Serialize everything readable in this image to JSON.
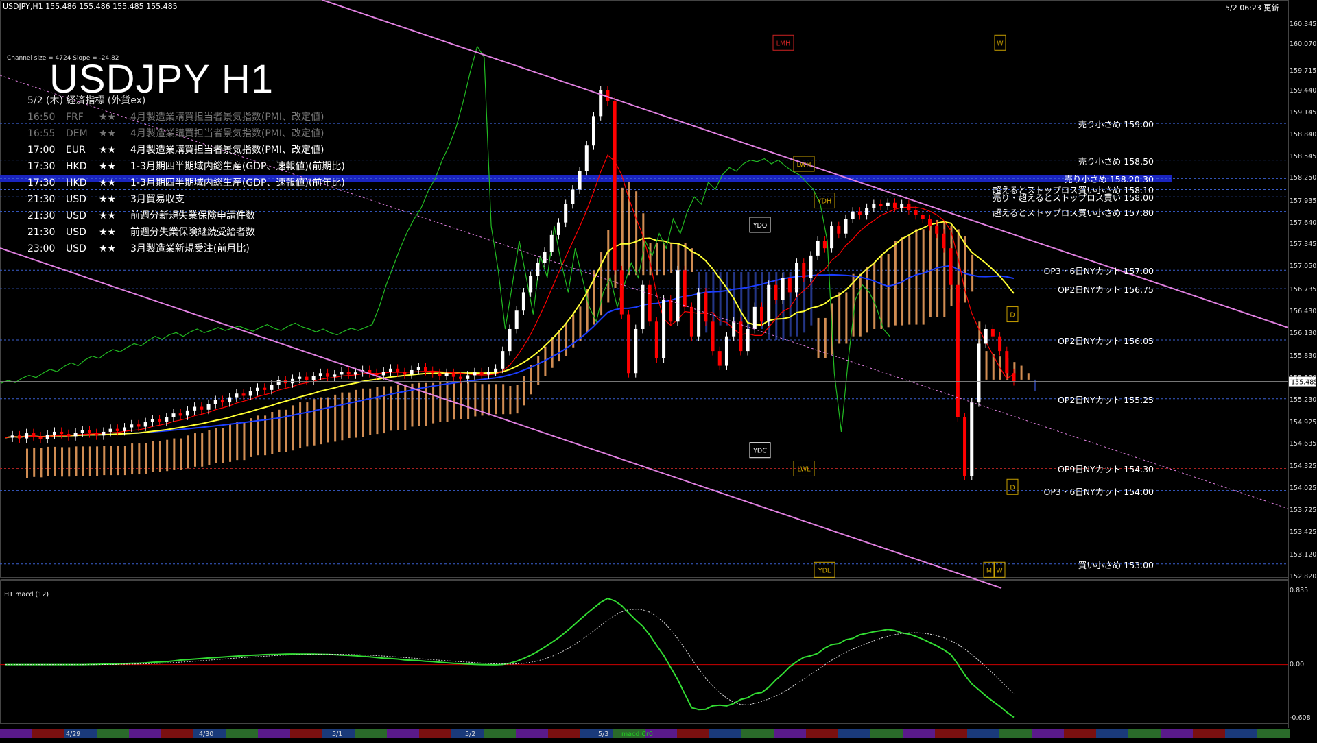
{
  "window": {
    "header": "USDJPY,H1  155.486 155.486 155.485 155.485",
    "timestamp": "5/2 06:23 更新"
  },
  "title": "USDJPY H1",
  "subtitle": "5/2 (木) 経済指標 (外貨ex)",
  "channel_info": "Channel size = 4724 Slope = -24.82",
  "colors": {
    "background": "#000000",
    "bull_candle": "#ffffff",
    "bear_candle": "#ff0000",
    "ma_fast": "#ff0000",
    "ma_mid": "#ffff33",
    "ma_slow": "#1a3cff",
    "chikou": "#22bb22",
    "cloud_bull": "#f4a460",
    "cloud_bear": "#2a3f9f",
    "channel": "#e080e0",
    "grid_dash": "#3a5fcf",
    "highlight_band": "#1a24c0"
  },
  "news": [
    {
      "time": "16:50",
      "currency": "FRF",
      "stars": "★★",
      "event": "4月製造業購買担当者景気指数(PMI、改定値)",
      "past": true
    },
    {
      "time": "16:55",
      "currency": "DEM",
      "stars": "★★",
      "event": "4月製造業購買担当者景気指数(PMI、改定値)",
      "past": true
    },
    {
      "time": "17:00",
      "currency": "EUR",
      "stars": "★★",
      "event": "4月製造業購買担当者景気指数(PMI、改定値)",
      "past": false
    },
    {
      "time": "17:30",
      "currency": "HKD",
      "stars": "★★",
      "event": "1-3月期四半期域内総生産(GDP、速報値)(前期比)",
      "past": false
    },
    {
      "time": "17:30",
      "currency": "HKD",
      "stars": "★★",
      "event": "1-3月期四半期域内総生産(GDP、速報値)(前年比)",
      "past": false
    },
    {
      "time": "21:30",
      "currency": "USD",
      "stars": "★★",
      "event": "3月貿易収支",
      "past": false
    },
    {
      "time": "21:30",
      "currency": "USD",
      "stars": "★★",
      "event": "前週分新規失業保険申請件数",
      "past": false
    },
    {
      "time": "21:30",
      "currency": "USD",
      "stars": "★★",
      "event": "前週分失業保険継続受給者数",
      "past": false
    },
    {
      "time": "23:00",
      "currency": "USD",
      "stars": "★★",
      "event": "3月製造業新規受注(前月比)",
      "past": false
    }
  ],
  "levels": [
    {
      "label": "売り小さめ 159.00",
      "price": 159.0
    },
    {
      "label": "売り小さめ 158.50",
      "price": 158.5
    },
    {
      "label": "売り小さめ 158.20-30",
      "price": 158.25
    },
    {
      "label": "超えるとストップロス買い小さめ 158.10",
      "price": 158.1
    },
    {
      "label": "売り・超えるとストップロス買い 158.00",
      "price": 158.0
    },
    {
      "label": "超えるとストップロス買い小さめ 157.80",
      "price": 157.8
    },
    {
      "label": "OP3・6日NYカット 157.00",
      "price": 157.0
    },
    {
      "label": "OP2日NYカット 156.75",
      "price": 156.75
    },
    {
      "label": "OP2日NYカット 156.05",
      "price": 156.05
    },
    {
      "label": "OP2日NYカット 155.25",
      "price": 155.25
    },
    {
      "label": "OP9日NYカット 154.30",
      "price": 154.3
    },
    {
      "label": "OP3・6日NYカット 154.00",
      "price": 154.0
    },
    {
      "label": "買い小さめ 153.00",
      "price": 153.0
    }
  ],
  "markers": [
    {
      "label": "LMH",
      "price": 160.1
    },
    {
      "label": "W",
      "price": 160.1
    },
    {
      "label": "LWH",
      "price": 158.45
    },
    {
      "label": "YDH",
      "price": 157.95
    },
    {
      "label": "YDO",
      "price": 157.62
    },
    {
      "label": "YDC",
      "price": 154.55
    },
    {
      "label": "LWL",
      "price": 154.3
    },
    {
      "label": "YDL",
      "price": 152.92
    },
    {
      "label": "D",
      "price": 156.4
    },
    {
      "label": "D",
      "price": 154.05
    },
    {
      "label": "W",
      "price": 152.92
    },
    {
      "label": "M",
      "price": 152.92
    }
  ],
  "current_price": "155.485",
  "macd_label": "H1  macd (12)",
  "macd_tag": "macd Cr0",
  "date_labels": [
    "4/29",
    "4/30",
    "5/1",
    "5/2",
    "5/3"
  ],
  "chart_data": [
    {
      "type": "candlestick",
      "title": "USDJPY H1",
      "ylim": [
        152.82,
        160.42
      ],
      "yticks": [
        "160.345",
        "160.070",
        "159.715",
        "159.440",
        "159.145",
        "158.840",
        "158.545",
        "158.250",
        "157.935",
        "157.640",
        "157.345",
        "157.050",
        "156.735",
        "156.430",
        "156.130",
        "155.830",
        "155.530",
        "155.230",
        "154.925",
        "154.635",
        "154.325",
        "154.025",
        "153.725",
        "153.425",
        "153.120",
        "152.820"
      ],
      "close_series": [
        154.72,
        154.75,
        154.71,
        154.78,
        154.74,
        154.7,
        154.76,
        154.8,
        154.77,
        154.74,
        154.79,
        154.82,
        154.78,
        154.75,
        154.8,
        154.84,
        154.81,
        154.86,
        154.9,
        154.87,
        154.93,
        154.97,
        154.94,
        155.0,
        155.05,
        155.02,
        155.09,
        155.14,
        155.1,
        155.18,
        155.23,
        155.2,
        155.27,
        155.32,
        155.29,
        155.35,
        155.4,
        155.37,
        155.44,
        155.5,
        155.46,
        155.52,
        155.55,
        155.5,
        155.56,
        155.6,
        155.55,
        155.58,
        155.62,
        155.58,
        155.61,
        155.64,
        155.6,
        155.57,
        155.62,
        155.66,
        155.61,
        155.58,
        155.64,
        155.68,
        155.63,
        155.6,
        155.56,
        155.6,
        155.55,
        155.52,
        155.57,
        155.61,
        155.58,
        155.62,
        155.66,
        155.9,
        156.2,
        156.45,
        156.7,
        156.92,
        157.1,
        157.25,
        157.48,
        157.65,
        157.9,
        158.1,
        158.35,
        158.7,
        159.1,
        159.45,
        159.3,
        157.0,
        156.4,
        155.6,
        156.2,
        156.8,
        156.3,
        155.8,
        156.6,
        156.3,
        157.0,
        156.5,
        156.1,
        156.7,
        156.3,
        155.9,
        155.7,
        156.1,
        156.3,
        155.9,
        156.2,
        156.5,
        156.3,
        156.8,
        156.6,
        156.9,
        156.7,
        157.1,
        156.9,
        157.2,
        157.4,
        157.3,
        157.6,
        157.5,
        157.7,
        157.8,
        157.75,
        157.85,
        157.9,
        157.88,
        157.92,
        157.85,
        157.9,
        157.82,
        157.75,
        157.7,
        157.6,
        157.5,
        157.3,
        156.8,
        155.0,
        154.2,
        155.2,
        156.0,
        156.2,
        156.1,
        155.9,
        155.6,
        155.49
      ],
      "macd_ylim": [
        -0.608,
        0.835
      ],
      "macd_yticks": [
        "0.835",
        "0.00",
        "-0.608"
      ]
    }
  ]
}
